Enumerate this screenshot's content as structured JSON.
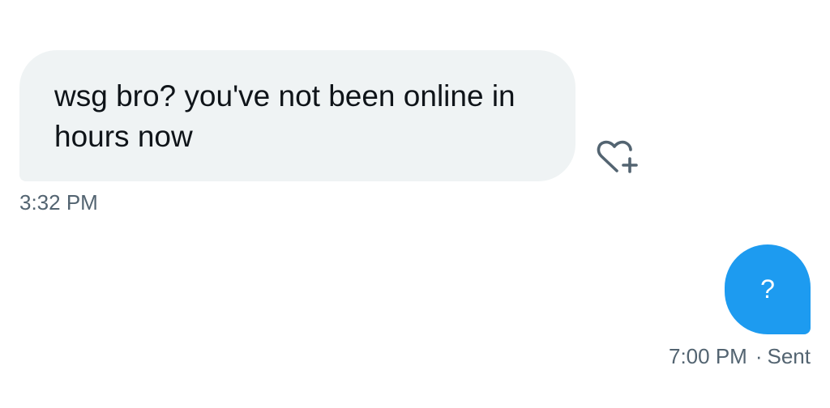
{
  "conversation": {
    "received": {
      "text": "wsg bro? you've not been online in hours now",
      "time": "3:32 PM",
      "react_icon": "heart-plus-icon"
    },
    "sent": {
      "text": "?",
      "time": "7:00 PM",
      "separator": "·",
      "status": "Sent"
    }
  },
  "colors": {
    "received_bubble": "#eff3f4",
    "sent_bubble": "#1d9bf0",
    "text_primary": "#0f1419",
    "text_secondary": "#536471"
  }
}
